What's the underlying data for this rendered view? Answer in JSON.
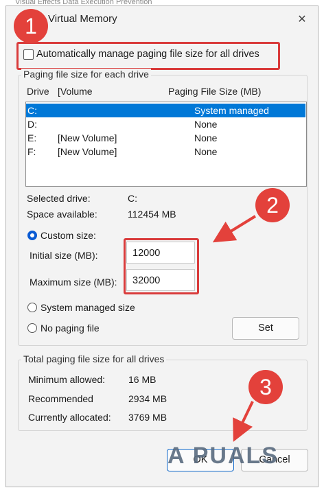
{
  "background_text": "Visual Effects    Data Execution Prevention",
  "window": {
    "title": "Virtual Memory",
    "close_glyph": "✕"
  },
  "auto_manage": {
    "checked": false,
    "label": "Automatically manage paging file size for all drives"
  },
  "paging_group": {
    "label": "Paging file size for each drive",
    "columns": [
      "Drive",
      "[Volume",
      "Paging File Size (MB)"
    ],
    "rows": [
      {
        "drive": "C:",
        "volume": "",
        "size": "System managed",
        "selected": true
      },
      {
        "drive": "D:",
        "volume": "",
        "size": "None",
        "selected": false
      },
      {
        "drive": "E:",
        "volume": "[New Volume]",
        "size": "None",
        "selected": false
      },
      {
        "drive": "F:",
        "volume": "[New Volume]",
        "size": "None",
        "selected": false
      }
    ],
    "selected_drive_label": "Selected drive:",
    "selected_drive_value": "C:",
    "space_available_label": "Space available:",
    "space_available_value": "112454 MB",
    "custom_size_label": "Custom size:",
    "initial_size_label": "Initial size (MB):",
    "initial_size_value": "12000",
    "maximum_size_label": "Maximum size (MB):",
    "maximum_size_value": "32000",
    "system_managed_label": "System managed size",
    "no_paging_label": "No paging file",
    "selected_option": "custom",
    "set_button": "Set"
  },
  "total_group": {
    "label": "Total paging file size for all drives",
    "minimum_label": "Minimum allowed:",
    "minimum_value": "16 MB",
    "recommended_label": "Recommended",
    "recommended_value": "2934 MB",
    "allocated_label": "Currently allocated:",
    "allocated_value": "3769 MB"
  },
  "buttons": {
    "ok": "OK",
    "cancel": "Cancel"
  },
  "annotations": {
    "badge1": "1",
    "badge2": "2",
    "badge3": "3",
    "highlight_color": "#d93b3b"
  },
  "watermark": "A PUALS"
}
